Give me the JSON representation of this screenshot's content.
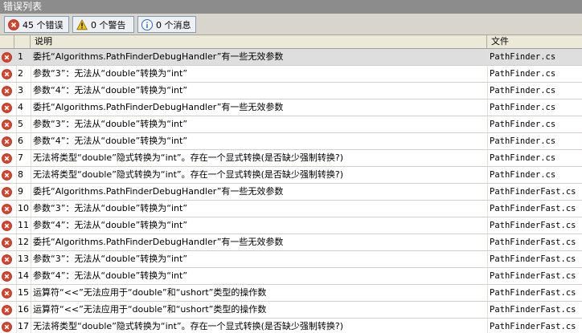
{
  "window": {
    "title": "错误列表"
  },
  "toolbar": {
    "errors_label": "45 个错误",
    "warnings_label": "0 个警告",
    "messages_label": "0 个消息"
  },
  "columns": {
    "description": "说明",
    "file": "文件"
  },
  "colors": {
    "title_bar": "#8c8c8c",
    "toolbar_bg": "#d8d5cc",
    "error_red": "#d8432c",
    "warning_yellow": "#f2c200",
    "info_blue": "#2a66c9",
    "selected_row": "#dedede"
  },
  "icons": {
    "error": "error-icon",
    "warning": "warning-icon",
    "info": "info-icon"
  },
  "rows": [
    {
      "num": "1",
      "desc": "委托“Algorithms.PathFinderDebugHandler”有一些无效参数",
      "file": "PathFinder.cs",
      "selected": true
    },
    {
      "num": "2",
      "desc": "参数“3”：无法从“double”转换为“int”",
      "file": "PathFinder.cs"
    },
    {
      "num": "3",
      "desc": "参数“4”：无法从“double”转换为“int”",
      "file": "PathFinder.cs"
    },
    {
      "num": "4",
      "desc": "委托“Algorithms.PathFinderDebugHandler”有一些无效参数",
      "file": "PathFinder.cs"
    },
    {
      "num": "5",
      "desc": "参数“3”：无法从“double”转换为“int”",
      "file": "PathFinder.cs"
    },
    {
      "num": "6",
      "desc": "参数“4”：无法从“double”转换为“int”",
      "file": "PathFinder.cs"
    },
    {
      "num": "7",
      "desc": "无法将类型“double”隐式转换为“int”。存在一个显式转换(是否缺少强制转换?)",
      "file": "PathFinder.cs"
    },
    {
      "num": "8",
      "desc": "无法将类型“double”隐式转换为“int”。存在一个显式转换(是否缺少强制转换?)",
      "file": "PathFinder.cs"
    },
    {
      "num": "9",
      "desc": "委托“Algorithms.PathFinderDebugHandler”有一些无效参数",
      "file": "PathFinderFast.cs"
    },
    {
      "num": "10",
      "desc": "参数“3”：无法从“double”转换为“int”",
      "file": "PathFinderFast.cs"
    },
    {
      "num": "11",
      "desc": "参数“4”：无法从“double”转换为“int”",
      "file": "PathFinderFast.cs"
    },
    {
      "num": "12",
      "desc": "委托“Algorithms.PathFinderDebugHandler”有一些无效参数",
      "file": "PathFinderFast.cs"
    },
    {
      "num": "13",
      "desc": "参数“3”：无法从“double”转换为“int”",
      "file": "PathFinderFast.cs"
    },
    {
      "num": "14",
      "desc": "参数“4”：无法从“double”转换为“int”",
      "file": "PathFinderFast.cs"
    },
    {
      "num": "15",
      "desc": "运算符“<<”无法应用于“double”和“ushort”类型的操作数",
      "file": "PathFinderFast.cs"
    },
    {
      "num": "16",
      "desc": "运算符“<<”无法应用于“double”和“ushort”类型的操作数",
      "file": "PathFinderFast.cs"
    },
    {
      "num": "17",
      "desc": "无法将类型“double”隐式转换为“int”。存在一个显式转换(是否缺少强制转换?)",
      "file": "PathFinderFast.cs"
    }
  ]
}
